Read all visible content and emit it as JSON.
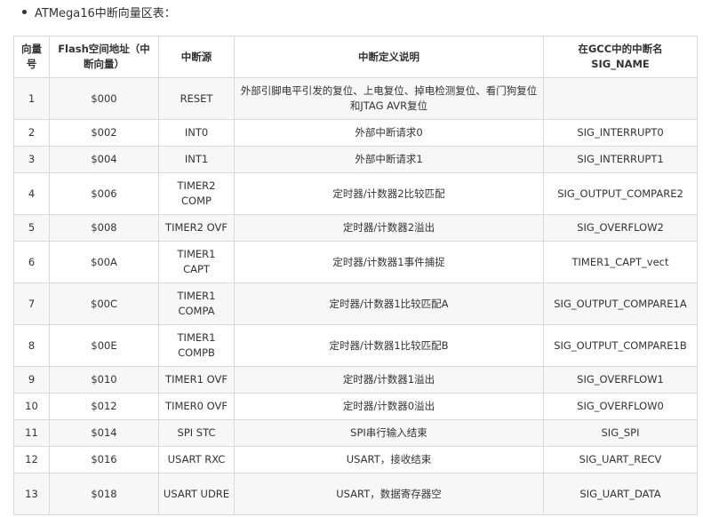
{
  "intro": {
    "text": "ATMega16中断向量区表："
  },
  "table": {
    "headers": [
      "向量号",
      "Flash空间地址（中断向量）",
      "中断源",
      "中断定义说明",
      "在GCC中的中断名 SIG_NAME"
    ],
    "rows": [
      [
        "1",
        "$000",
        "RESET",
        "外部引脚电平引发的复位、上电复位、掉电检测复位、看门狗复位和JTAG AVR复位",
        ""
      ],
      [
        "2",
        "$002",
        "INT0",
        "外部中断请求0",
        "SIG_INTERRUPT0"
      ],
      [
        "3",
        "$004",
        "INT1",
        "外部中断请求1",
        "SIG_INTERRUPT1"
      ],
      [
        "4",
        "$006",
        "TIMER2 COMP",
        "定时器/计数器2比较匹配",
        "SIG_OUTPUT_COMPARE2"
      ],
      [
        "5",
        "$008",
        "TIMER2 OVF",
        "定时器/计数器2溢出",
        "SIG_OVERFLOW2"
      ],
      [
        "6",
        "$00A",
        "TIMER1 CAPT",
        "定时器/计数器1事件捕捉",
        "TIMER1_CAPT_vect"
      ],
      [
        "7",
        "$00C",
        "TIMER1 COMPA",
        "定时器/计数器1比较匹配A",
        "SIG_OUTPUT_COMPARE1A"
      ],
      [
        "8",
        "$00E",
        "TIMER1 COMPB",
        "定时器/计数器1比较匹配B",
        "SIG_OUTPUT_COMPARE1B"
      ],
      [
        "9",
        "$010",
        "TIMER1 OVF",
        "定时器/计数器1溢出",
        "SIG_OVERFLOW1"
      ],
      [
        "10",
        "$012",
        "TIMER0 OVF",
        "定时器/计数器0溢出",
        "SIG_OVERFLOW0"
      ],
      [
        "11",
        "$014",
        "SPI STC",
        "SPI串行输入结束",
        "SIG_SPI"
      ],
      [
        "12",
        "$016",
        "USART RXC",
        "USART，接收结束",
        "SIG_UART_RECV"
      ],
      [
        "13",
        "$018",
        "USART UDRE",
        "USART，数据寄存器空",
        "SIG_UART_DATA"
      ]
    ]
  }
}
